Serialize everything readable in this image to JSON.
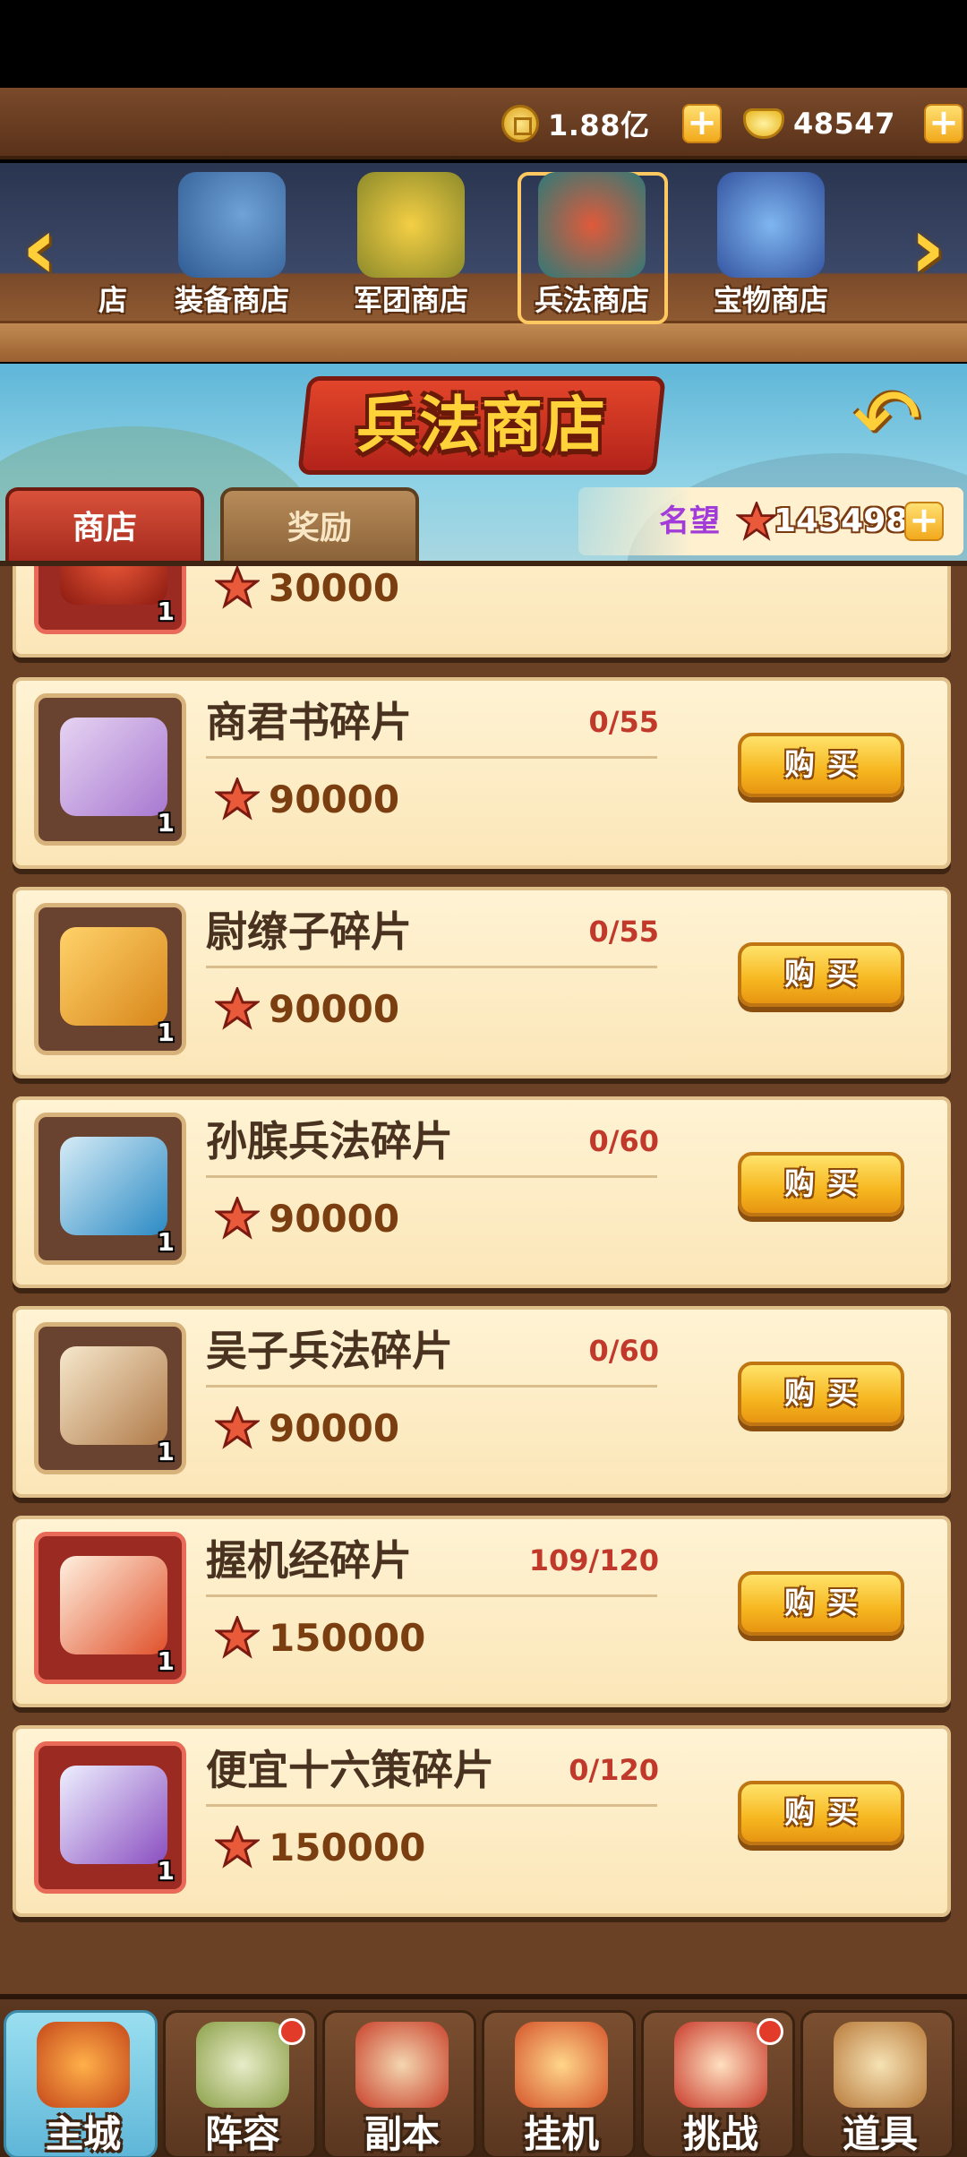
{
  "currency": {
    "coins": "1.88亿",
    "gold": "48547"
  },
  "shops": {
    "partial_label": "店",
    "tabs": [
      {
        "label": "装备商店"
      },
      {
        "label": "军团商店"
      },
      {
        "label": "兵法商店"
      },
      {
        "label": "宝物商店"
      }
    ]
  },
  "header": {
    "title": "兵法商店",
    "subtabs": {
      "shop": "商店",
      "reward": "奖励"
    },
    "fame_label": "名望",
    "fame_value": "143498"
  },
  "items": [
    {
      "name": "",
      "progress": "",
      "price": "30000",
      "qty": "1"
    },
    {
      "name": "商君书碎片",
      "progress": "0/55",
      "price": "90000",
      "qty": "1"
    },
    {
      "name": "尉缭子碎片",
      "progress": "0/55",
      "price": "90000",
      "qty": "1"
    },
    {
      "name": "孙膑兵法碎片",
      "progress": "0/60",
      "price": "90000",
      "qty": "1"
    },
    {
      "name": "吴子兵法碎片",
      "progress": "0/60",
      "price": "90000",
      "qty": "1"
    },
    {
      "name": "握机经碎片",
      "progress": "109/120",
      "price": "150000",
      "qty": "1"
    },
    {
      "name": "便宜十六策碎片",
      "progress": "0/120",
      "price": "150000",
      "qty": "1"
    }
  ],
  "buy_label": "购买",
  "nav": {
    "items": [
      {
        "label": "主城"
      },
      {
        "label": "阵容"
      },
      {
        "label": "副本"
      },
      {
        "label": "挂机"
      },
      {
        "label": "挑战"
      },
      {
        "label": "道具"
      }
    ]
  },
  "colors": {
    "accent_gold": "#f6b61f",
    "price_red": "#c0392b",
    "fame_purple": "#a23cd8"
  }
}
